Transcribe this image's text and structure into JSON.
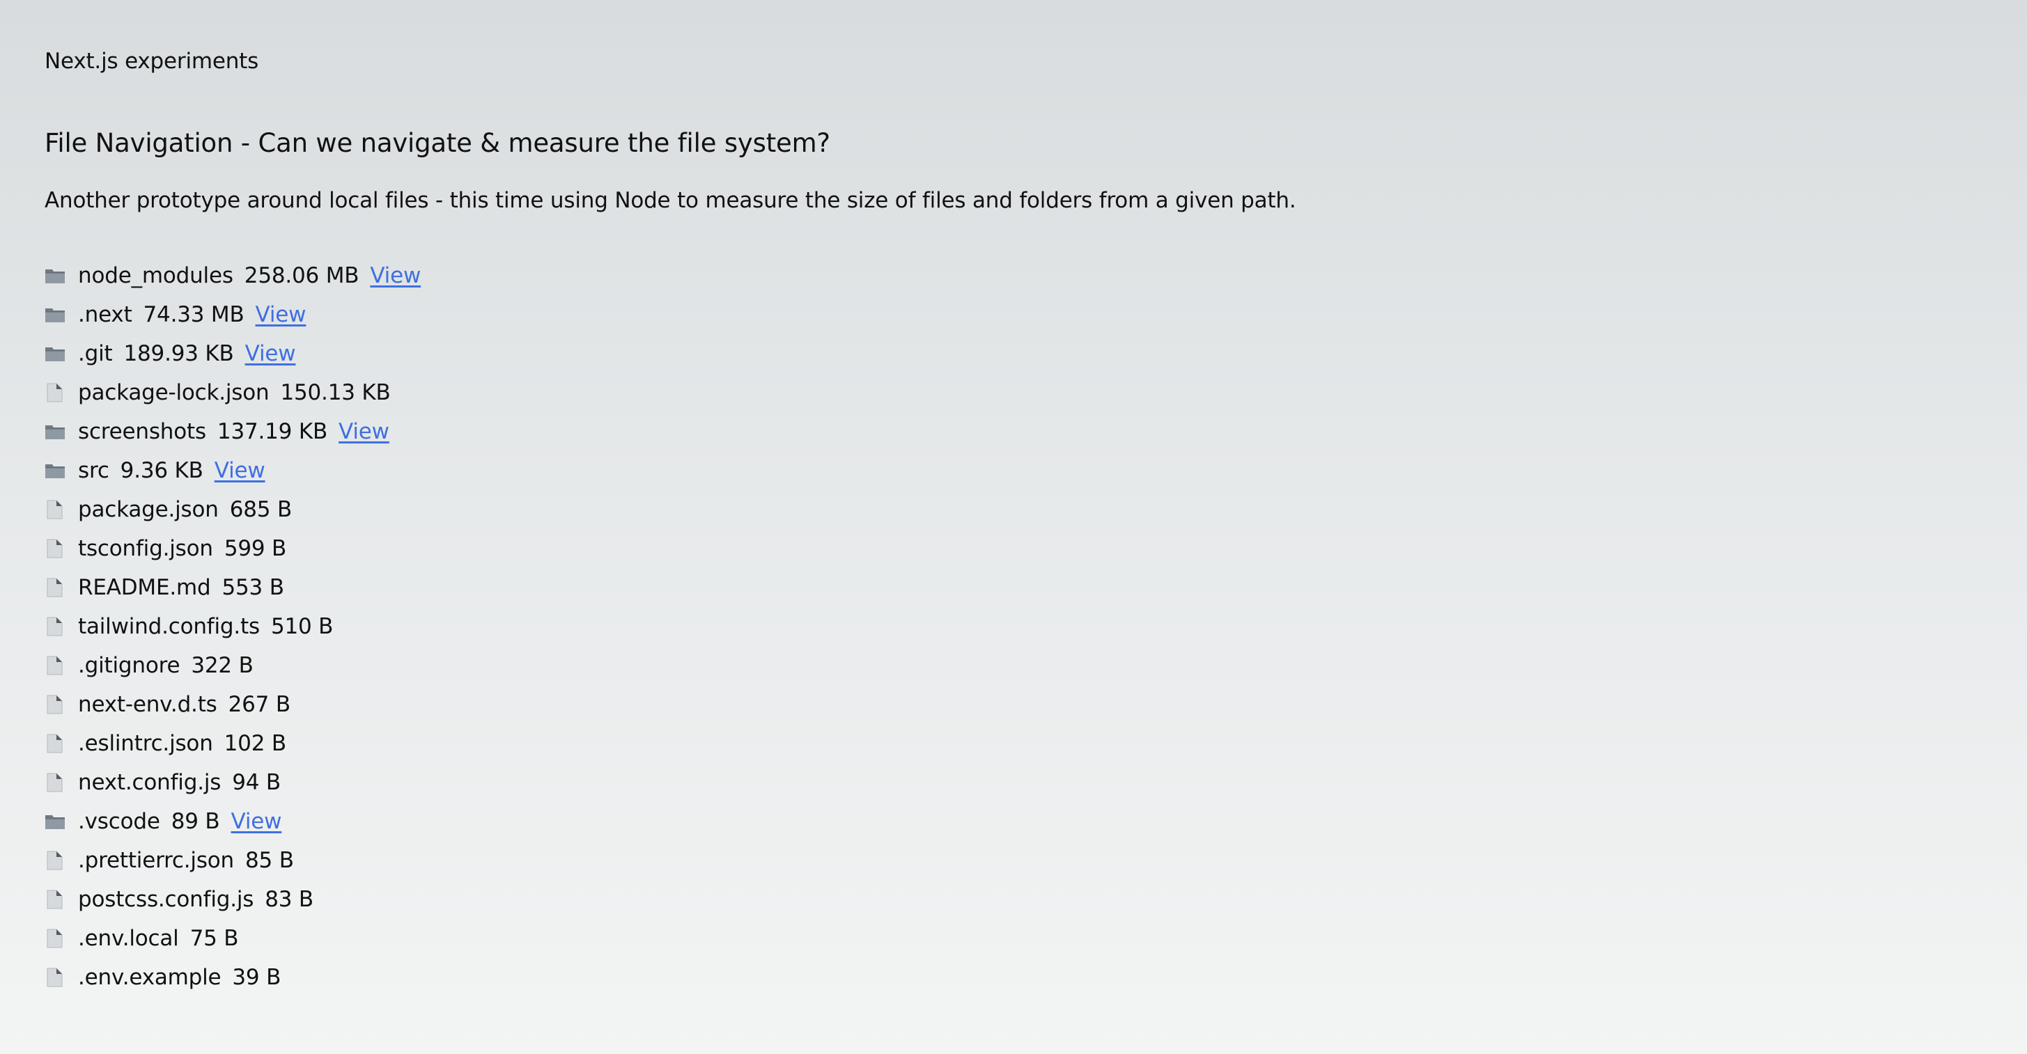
{
  "header": {
    "app_title": "Next.js experiments"
  },
  "main": {
    "heading": "File Navigation - Can we navigate & measure the file system?",
    "description": "Another prototype around local files - this time using Node to measure the size of files and folders from a given path.",
    "entries": [
      {
        "icon": "folder-icon",
        "name": "node_modules",
        "size": "258.06 MB",
        "link": "View"
      },
      {
        "icon": "folder-icon",
        "name": ".next",
        "size": "74.33 MB",
        "link": "View"
      },
      {
        "icon": "folder-icon",
        "name": ".git",
        "size": "189.93 KB",
        "link": "View"
      },
      {
        "icon": "file-icon",
        "name": "package-lock.json",
        "size": "150.13 KB"
      },
      {
        "icon": "folder-icon",
        "name": "screenshots",
        "size": "137.19 KB",
        "link": "View"
      },
      {
        "icon": "folder-icon",
        "name": "src",
        "size": "9.36 KB",
        "link": "View"
      },
      {
        "icon": "file-icon",
        "name": "package.json",
        "size": "685 B"
      },
      {
        "icon": "file-icon",
        "name": "tsconfig.json",
        "size": "599 B"
      },
      {
        "icon": "file-icon",
        "name": "README.md",
        "size": "553 B"
      },
      {
        "icon": "file-icon",
        "name": "tailwind.config.ts",
        "size": "510 B"
      },
      {
        "icon": "file-icon",
        "name": ".gitignore",
        "size": "322 B"
      },
      {
        "icon": "file-icon",
        "name": "next-env.d.ts",
        "size": "267 B"
      },
      {
        "icon": "file-icon",
        "name": ".eslintrc.json",
        "size": "102 B"
      },
      {
        "icon": "file-icon",
        "name": "next.config.js",
        "size": "94 B"
      },
      {
        "icon": "folder-icon",
        "name": ".vscode",
        "size": "89 B",
        "link": "View"
      },
      {
        "icon": "file-icon",
        "name": ".prettierrc.json",
        "size": "85 B"
      },
      {
        "icon": "file-icon",
        "name": "postcss.config.js",
        "size": "83 B"
      },
      {
        "icon": "file-icon",
        "name": ".env.local",
        "size": "75 B"
      },
      {
        "icon": "file-icon",
        "name": ".env.example",
        "size": "39 B"
      }
    ]
  },
  "colors": {
    "link": "#3f6fe0",
    "text": "#111111",
    "folder": "#7c8791",
    "file": "#d0d3d6"
  }
}
